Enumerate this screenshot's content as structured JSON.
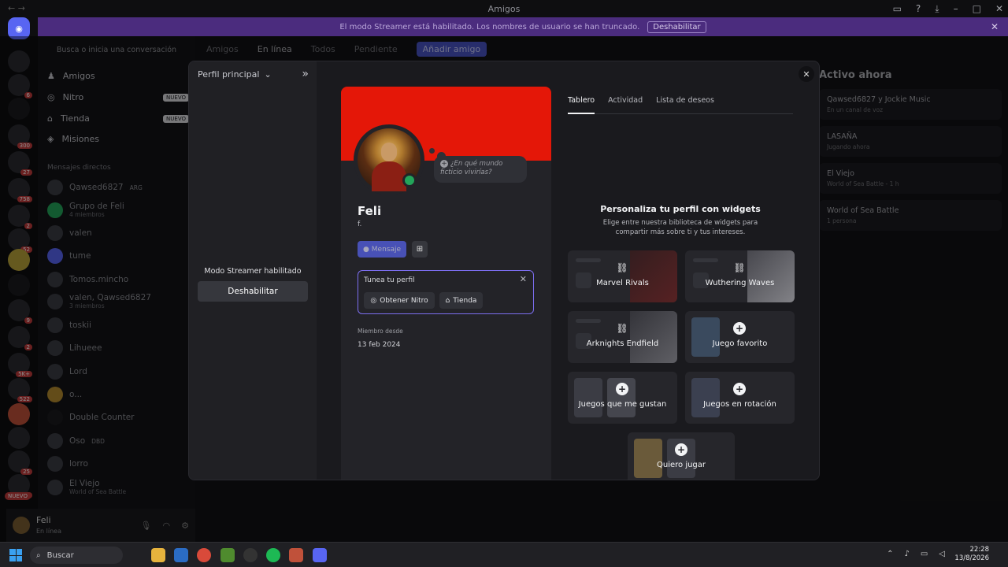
{
  "window": {
    "title": "Amigos"
  },
  "streamer_banner": {
    "text": "El modo Streamer está habilitado. Los nombres de usuario se han truncado.",
    "button": "Deshabilitar"
  },
  "sidebar": {
    "search_placeholder": "Busca o inicia una conversación",
    "nav": [
      {
        "label": "Amigos",
        "tag": ""
      },
      {
        "label": "Nitro",
        "tag": "NUEVO"
      },
      {
        "label": "Tienda",
        "tag": "NUEVO"
      },
      {
        "label": "Misiones",
        "tag": ""
      }
    ],
    "dm_header": "Mensajes directos",
    "dms": [
      {
        "name": "Qawsed6827",
        "sub": "",
        "tag": "ARG"
      },
      {
        "name": "Grupo de Feli",
        "sub": "4 miembros"
      },
      {
        "name": "valen",
        "sub": ""
      },
      {
        "name": "tume",
        "sub": ""
      },
      {
        "name": "Tomos.mincho",
        "sub": ""
      },
      {
        "name": "valen, Qawsed6827",
        "sub": "3 miembros"
      },
      {
        "name": "toskii",
        "sub": ""
      },
      {
        "name": "Lihueee",
        "sub": ""
      },
      {
        "name": "Lord",
        "sub": ""
      },
      {
        "name": "o...",
        "sub": ""
      },
      {
        "name": "Double Counter",
        "sub": ""
      },
      {
        "name": "Oso",
        "sub": "",
        "tag": "DBD"
      },
      {
        "name": "lorro",
        "sub": ""
      },
      {
        "name": "El Viejo",
        "sub": "World of Sea Battle"
      }
    ],
    "rail_badge": "NUEVO",
    "user": {
      "name": "Feli",
      "status": "En línea"
    }
  },
  "topbar": {
    "tabs": [
      "Amigos",
      "En línea",
      "Todos",
      "Pendiente"
    ],
    "add_friend": "Añadir amigo"
  },
  "active_now": {
    "title": "Activo ahora",
    "items": [
      {
        "title": "Qawsed6827 y Jockie Music",
        "sub": "En un canal de voz"
      },
      {
        "title": "LASAÑA",
        "sub": "Jugando ahora"
      },
      {
        "title": "El Viejo",
        "sub": "World of Sea Battle - 1 h"
      },
      {
        "title": "World of Sea Battle",
        "sub": "1 persona"
      }
    ]
  },
  "modal": {
    "profile_selector": "Perfil principal",
    "streamer_msg": "Modo Streamer habilitado",
    "disable_button": "Deshabilitar",
    "status_bubble": "¿En qué mundo ficticio vivirías?",
    "display_name": "Feli",
    "username": "f.",
    "message_button": "Mensaje",
    "tune": {
      "title": "Tunea tu perfil",
      "nitro": "Obtener Nitro",
      "shop": "Tienda"
    },
    "member_since_label": "Miembro desde",
    "member_since": "13 feb 2024",
    "tabs": [
      "Tablero",
      "Actividad",
      "Lista de deseos"
    ],
    "widgets_title": "Personaliza tu perfil con widgets",
    "widgets_desc": "Elige entre nuestra biblioteca de widgets para compartir más sobre ti y tus intereses.",
    "widgets": [
      {
        "label": "Marvel Rivals",
        "icon": "link-icon"
      },
      {
        "label": "Wuthering Waves",
        "icon": "link-icon"
      },
      {
        "label": "Arknights Endfield",
        "icon": "link-icon"
      },
      {
        "label": "Juego favorito",
        "icon": "plus-icon"
      },
      {
        "label": "Juegos que me gustan",
        "icon": "plus-icon"
      },
      {
        "label": "Juegos en rotación",
        "icon": "plus-icon"
      },
      {
        "label": "Quiero jugar",
        "icon": "plus-icon"
      }
    ],
    "colors": {
      "banner": "#e41708",
      "online": "#23a55a",
      "accent": "#5865f2"
    }
  },
  "taskbar": {
    "search": "Buscar",
    "time": "22:28",
    "date": "13/8/2026"
  }
}
